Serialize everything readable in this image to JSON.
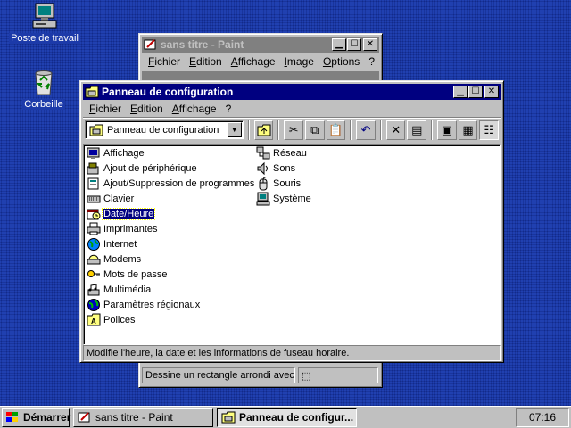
{
  "desktop": {
    "icons": [
      {
        "label": "Poste de travail",
        "icon": "computer-icon"
      },
      {
        "label": "Corbeille",
        "icon": "recycle-bin-icon"
      }
    ]
  },
  "paint_window": {
    "title": "sans titre - Paint",
    "menus": [
      "Fichier",
      "Edition",
      "Affichage",
      "Image",
      "Options",
      "?"
    ],
    "status_text": "Dessine un rectangle arrondi avec"
  },
  "control_panel": {
    "title": "Panneau de configuration",
    "menus": [
      "Fichier",
      "Edition",
      "Affichage",
      "?"
    ],
    "address_value": "Panneau de configuration",
    "items_col1": [
      {
        "label": "Affichage",
        "icon": "display-icon"
      },
      {
        "label": "Ajout de périphérique",
        "icon": "add-hardware-icon"
      },
      {
        "label": "Ajout/Suppression de programmes",
        "icon": "add-remove-programs-icon"
      },
      {
        "label": "Clavier",
        "icon": "keyboard-icon"
      },
      {
        "label": "Date/Heure",
        "icon": "date-time-icon"
      },
      {
        "label": "Imprimantes",
        "icon": "printer-icon"
      },
      {
        "label": "Internet",
        "icon": "internet-icon"
      },
      {
        "label": "Modems",
        "icon": "modem-icon"
      },
      {
        "label": "Mots de passe",
        "icon": "passwords-icon"
      },
      {
        "label": "Multimédia",
        "icon": "multimedia-icon"
      },
      {
        "label": "Paramètres régionaux",
        "icon": "regional-settings-icon"
      },
      {
        "label": "Polices",
        "icon": "fonts-icon"
      }
    ],
    "items_col2": [
      {
        "label": "Réseau",
        "icon": "network-icon"
      },
      {
        "label": "Sons",
        "icon": "sounds-icon"
      },
      {
        "label": "Souris",
        "icon": "mouse-icon"
      },
      {
        "label": "Système",
        "icon": "system-icon"
      }
    ],
    "selected_item": "Date/Heure",
    "status_text": "Modifie l'heure, la date et les informations de fuseau horaire."
  },
  "taskbar": {
    "start_label": "Démarrer",
    "buttons": [
      {
        "label": "sans titre - Paint",
        "active": false
      },
      {
        "label": "Panneau de configur...",
        "active": true
      }
    ],
    "clock": "07:16"
  }
}
